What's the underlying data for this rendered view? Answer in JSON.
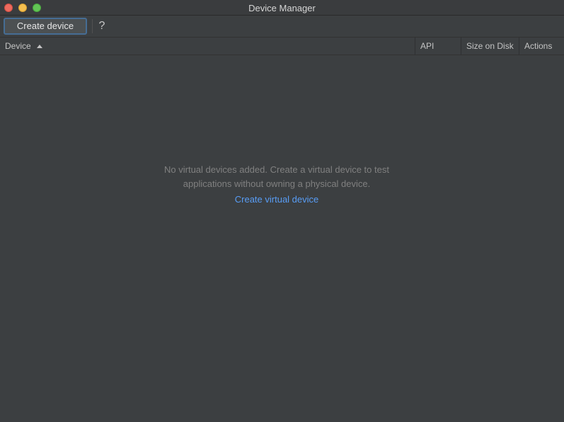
{
  "window": {
    "title": "Device Manager"
  },
  "toolbar": {
    "create_label": "Create device",
    "help_label": "?"
  },
  "table": {
    "columns": [
      {
        "label": "Device",
        "sort": "ascending"
      },
      {
        "label": "API"
      },
      {
        "label": "Size on Disk"
      },
      {
        "label": "Actions"
      }
    ]
  },
  "empty_state": {
    "line1": "No virtual devices added. Create a virtual device to test",
    "line2": "applications without owning a physical device.",
    "link_label": "Create virtual device"
  },
  "colors": {
    "background": "#3c3f41",
    "link": "#589df6",
    "focus_border": "#466d94"
  },
  "icons": [
    "close-icon",
    "minimize-icon",
    "zoom-icon",
    "sort-ascending-icon"
  ]
}
